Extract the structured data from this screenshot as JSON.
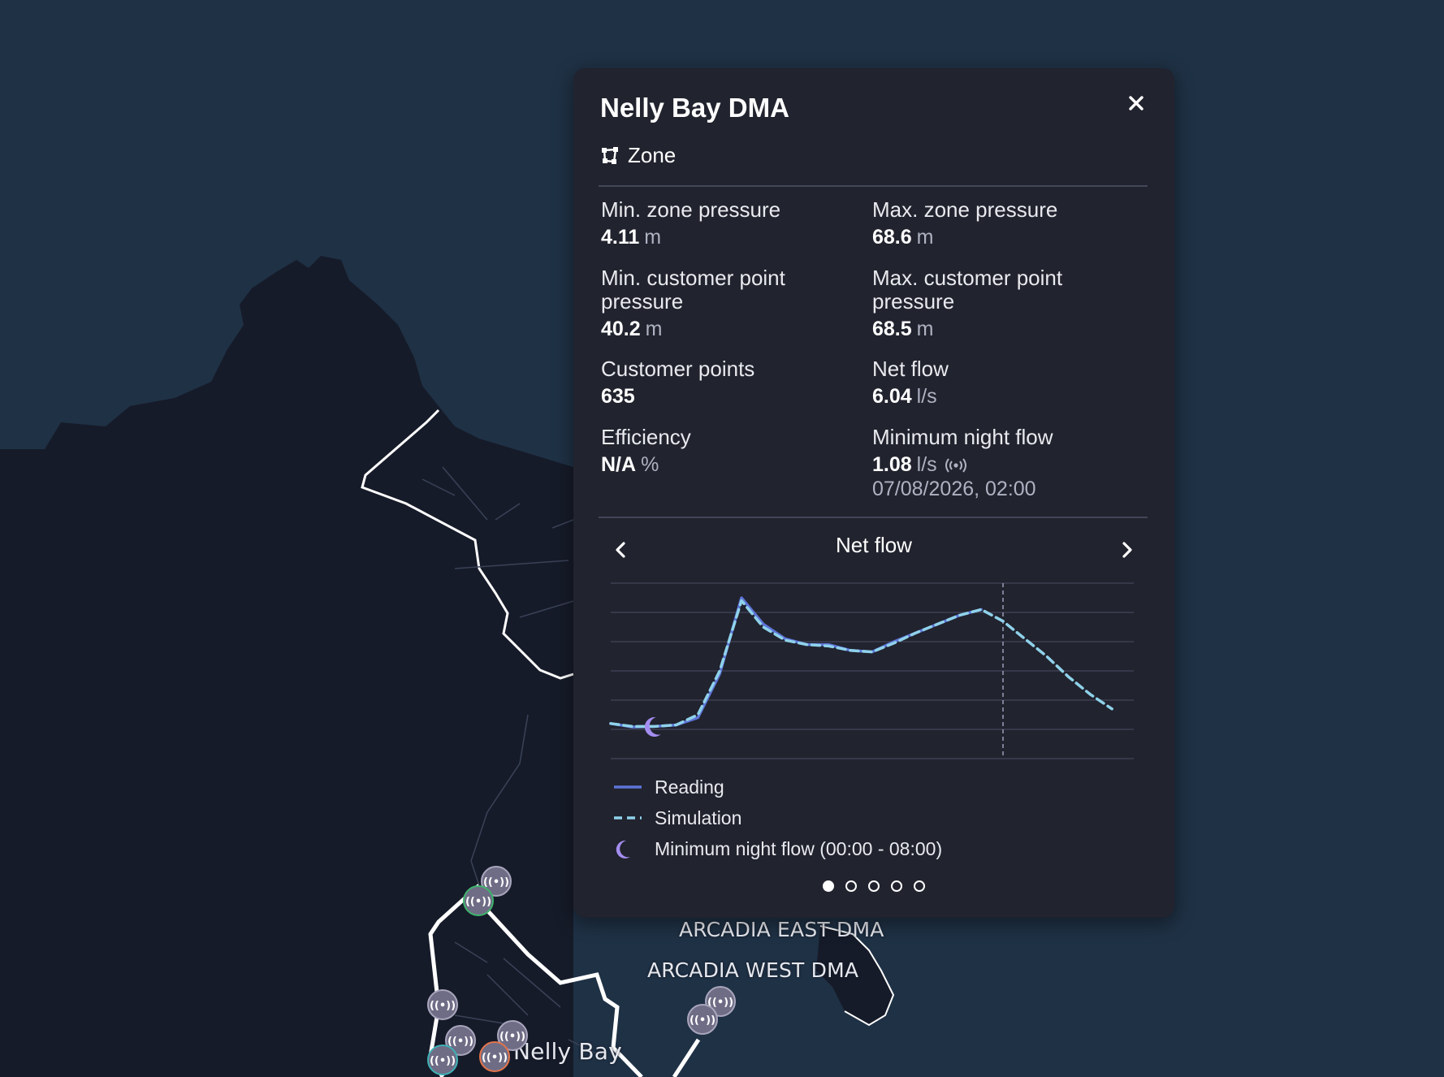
{
  "map": {
    "labels": {
      "arcadia_east": "ARCADIA EAST DMA",
      "arcadia_west": "ARCADIA WEST DMA",
      "nelly_bay": "Nelly Bay"
    },
    "colors": {
      "sea": "#1f3145",
      "land": "#161b29",
      "zone_outline": "#ffffff"
    },
    "sensor_icon": "radio-sensor-icon"
  },
  "panel": {
    "title": "Nelly Bay DMA",
    "type_label": "Zone",
    "type_icon": "zone-polygon-icon",
    "close_icon": "close-icon",
    "metrics": {
      "min_zone_pressure": {
        "label": "Min. zone pressure",
        "value": "4.11",
        "unit": "m"
      },
      "max_zone_pressure": {
        "label": "Max. zone pressure",
        "value": "68.6",
        "unit": "m"
      },
      "min_customer_point_pressure": {
        "label": "Min. customer point pressure",
        "value": "40.2",
        "unit": "m"
      },
      "max_customer_point_pressure": {
        "label": "Max. customer point pressure",
        "value": "68.5",
        "unit": "m"
      },
      "customer_points": {
        "label": "Customer points",
        "value": "635"
      },
      "net_flow": {
        "label": "Net flow",
        "value": "6.04",
        "unit": "l/s"
      },
      "efficiency": {
        "label": "Efficiency",
        "value": "N/A",
        "unit": "%"
      },
      "minimum_night_flow": {
        "label": "Minimum night flow",
        "value": "1.08",
        "unit": "l/s",
        "timestamp": "07/08/2026, 02:00"
      }
    },
    "chart_nav": {
      "prev_icon": "chevron-left-icon",
      "next_icon": "chevron-right-icon"
    },
    "pager": {
      "page_count": 5,
      "active_index": 0
    },
    "colors": {
      "panel_bg": "#21232e",
      "reading": "#5d74d6",
      "simulation": "#8fd2ea",
      "night_flow_marker": "#a48df0"
    }
  },
  "chart_data": {
    "type": "line",
    "title": "Net flow",
    "xlabel": "",
    "ylabel": "",
    "grid": true,
    "x_hours": [
      0,
      1,
      2,
      3,
      4,
      5,
      6,
      7,
      8,
      9,
      10,
      11,
      12,
      13,
      14,
      15,
      16,
      17,
      18,
      19,
      20,
      21,
      22,
      23
    ],
    "series": [
      {
        "name": "Reading",
        "style": "solid",
        "values": [
          1.2,
          1.08,
          1.1,
          1.15,
          1.4,
          2.9,
          5.5,
          4.6,
          4.1,
          3.9,
          3.9,
          3.7,
          3.65,
          4.0,
          4.3,
          4.6,
          4.9,
          5.1,
          null,
          null,
          null,
          null,
          null,
          null
        ]
      },
      {
        "name": "Simulation",
        "style": "dashed",
        "values": [
          1.2,
          1.1,
          1.1,
          1.15,
          1.5,
          3.0,
          5.4,
          4.5,
          4.05,
          3.9,
          3.85,
          3.7,
          3.65,
          3.95,
          4.3,
          4.6,
          4.9,
          5.1,
          4.7,
          4.1,
          3.5,
          2.8,
          2.2,
          1.7
        ]
      }
    ],
    "current_time_hour": 18,
    "minimum_night_flow": {
      "label": "Minimum night flow (00:00 - 08:00)",
      "x_hour": 2,
      "value": 1.08
    },
    "ylim": [
      0,
      6
    ]
  }
}
